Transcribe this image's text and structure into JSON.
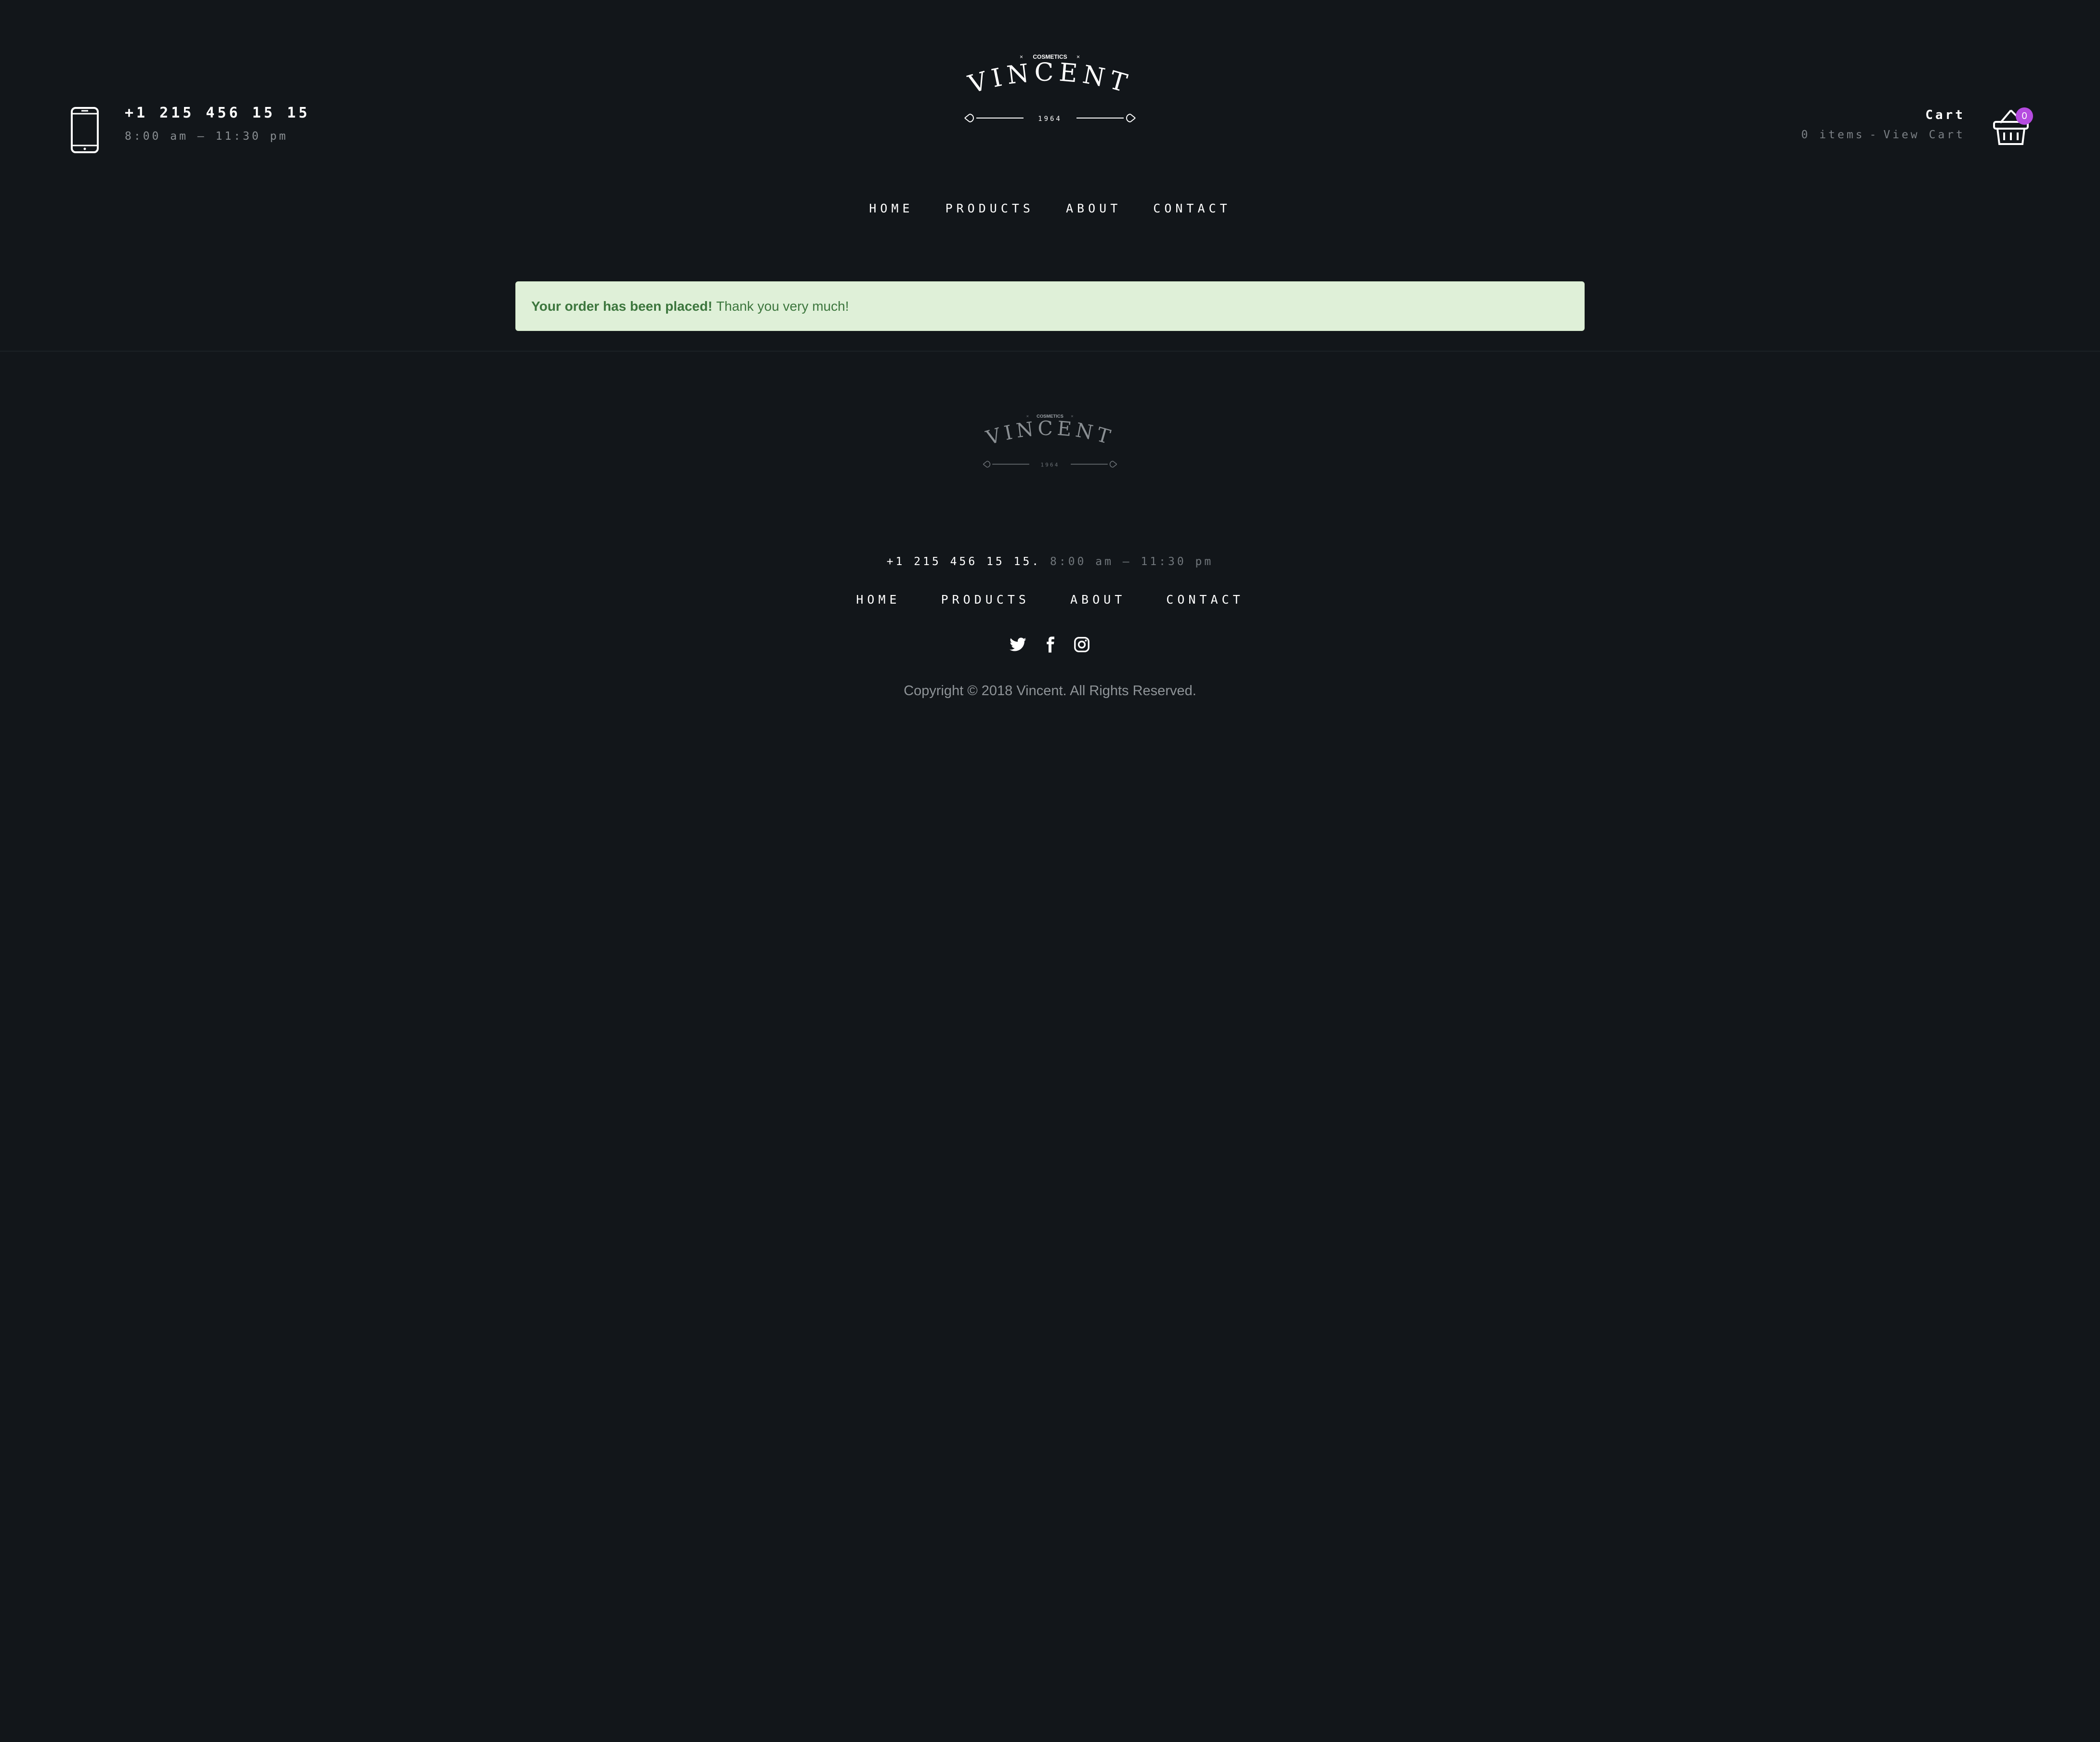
{
  "header": {
    "phone_number": "+1 215 456 15 15",
    "phone_hours": "8:00 am – 11:30 pm",
    "icons": {
      "phone": "smartphone-icon",
      "cart": "basket-icon"
    },
    "cart": {
      "title": "Cart",
      "items_text": "0 items",
      "separator": "-",
      "view_cart": "View Cart",
      "badge_count": "0"
    }
  },
  "logo": {
    "tagline": "COSMETICS",
    "name": "VINCENT",
    "year": "1964"
  },
  "nav": {
    "items": [
      {
        "label": "HOME"
      },
      {
        "label": "PRODUCTS"
      },
      {
        "label": "ABOUT"
      },
      {
        "label": "CONTACT"
      }
    ]
  },
  "alert": {
    "strong_text": "Your order has been placed!",
    "text": "Thank you very much!"
  },
  "footer": {
    "phone": "+1 215 456 15 15.",
    "hours": "8:00 am – 11:30 pm",
    "nav": [
      {
        "label": "HOME"
      },
      {
        "label": "PRODUCTS"
      },
      {
        "label": "ABOUT"
      },
      {
        "label": "CONTACT"
      }
    ],
    "social": [
      "twitter-icon",
      "facebook-icon",
      "instagram-icon"
    ],
    "copyright": "Copyright © 2018 Vincent. All Rights Reserved."
  },
  "colors": {
    "background": "#12161a",
    "accent_badge": "#b64be0",
    "alert_bg": "#dff0d8",
    "alert_text": "#3c763d"
  }
}
